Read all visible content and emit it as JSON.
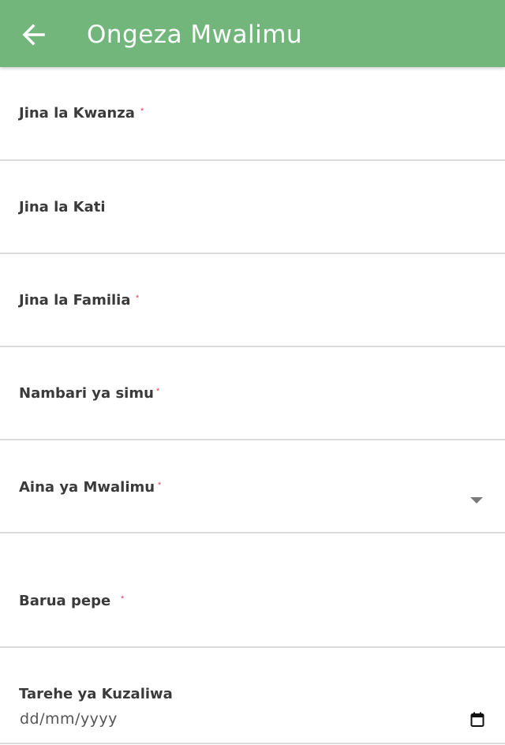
{
  "appbar": {
    "title": "Ongeza Mwalimu",
    "back_icon": "arrow-left-icon",
    "background": "#72b67c"
  },
  "form": {
    "required_marker": "*",
    "fields": [
      {
        "label": "Jina la Kwanza",
        "required": true,
        "type": "text"
      },
      {
        "label": "Jina la Kati",
        "required": false,
        "type": "text"
      },
      {
        "label": "Jina la Familia",
        "required": true,
        "type": "text"
      },
      {
        "label": "Nambari ya simu",
        "required": true,
        "type": "tel"
      },
      {
        "label": "Aina ya Mwalimu",
        "required": true,
        "type": "select",
        "icon": "chevron-down-icon"
      },
      {
        "label": "Barua pepe",
        "required": true,
        "type": "email"
      },
      {
        "label": "Tarehe ya Kuzaliwa",
        "required": false,
        "type": "date",
        "placeholder": "dd/mm/yyyy",
        "icon": "calendar-icon"
      }
    ]
  }
}
